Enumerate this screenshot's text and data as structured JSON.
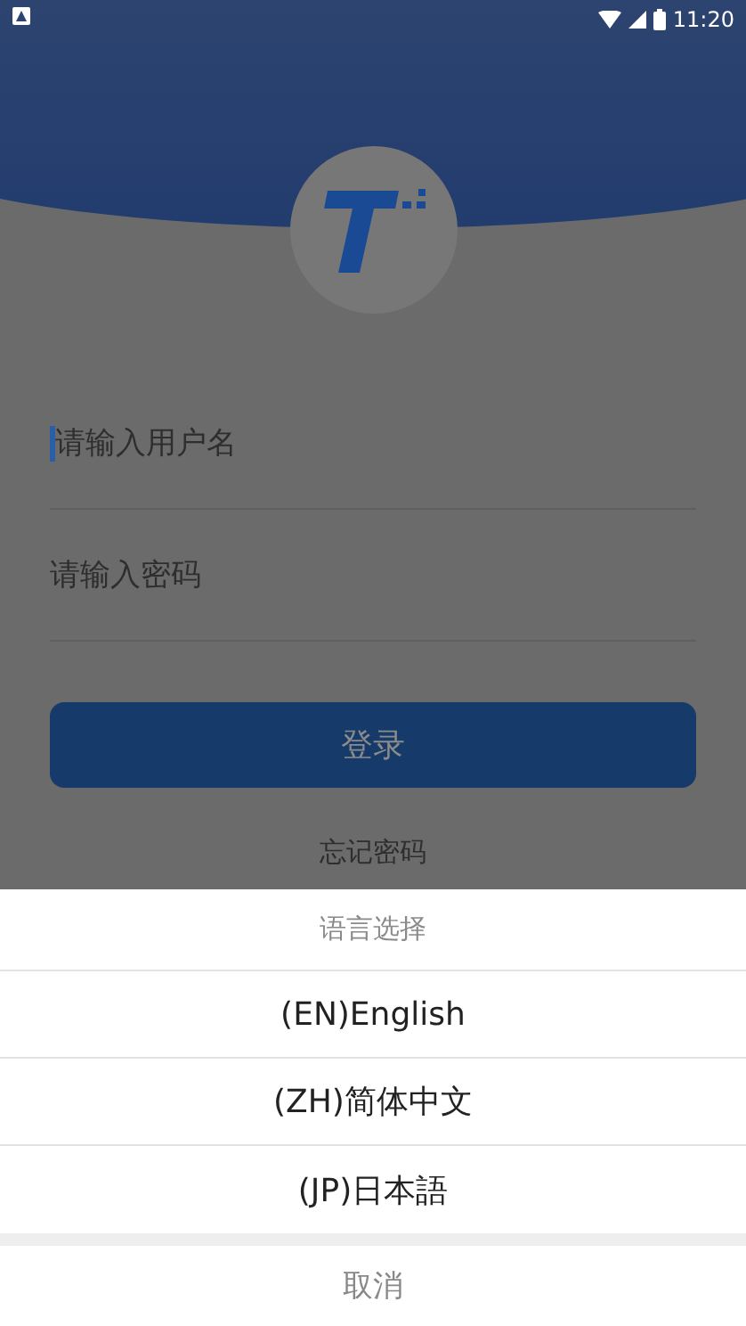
{
  "status_bar": {
    "time": "11:20"
  },
  "login": {
    "fields": [
      {
        "placeholder": "请输入用户名",
        "focused": true
      },
      {
        "placeholder": "请输入密码",
        "focused": false
      }
    ],
    "button": "登录",
    "forgot_link": "忘记密码"
  },
  "language_sheet": {
    "title": "语言选择",
    "options": [
      "(EN)English",
      "(ZH)简体中文",
      "(JP)日本語"
    ],
    "cancel": "取消"
  }
}
